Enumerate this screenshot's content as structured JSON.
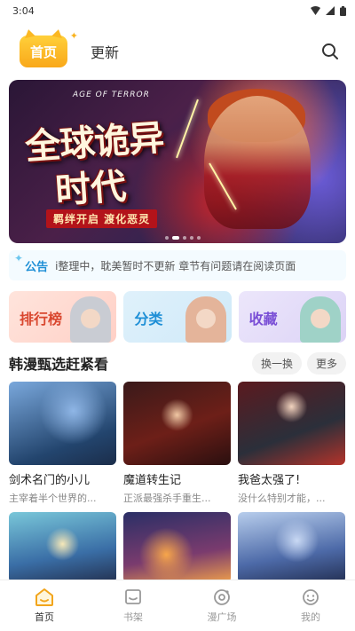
{
  "status_bar": {
    "time": "3:04"
  },
  "header": {
    "tabs": [
      {
        "label": "首页"
      },
      {
        "label": "更新"
      }
    ]
  },
  "banner": {
    "title_en": "AGE OF TERROR",
    "title_line1": "全球诡异",
    "title_line2": "时代",
    "tagline": "羁绊开启 渡化恶灵"
  },
  "notice": {
    "label": "公告",
    "text": "i整理中，耽美暂时不更新 章节有问题请在阅读页面"
  },
  "categories": [
    {
      "label": "排行榜"
    },
    {
      "label": "分类"
    },
    {
      "label": "收藏"
    }
  ],
  "section": {
    "title": "韩漫甄选赶紧看",
    "refresh_label": "换一换",
    "more_label": "更多"
  },
  "books": [
    {
      "title": "剑术名门的小儿",
      "desc": "主宰着半个世界的..."
    },
    {
      "title": "魔道转生记",
      "desc": "正派最强杀手重生..."
    },
    {
      "title": "我爸太强了!",
      "desc": "没什么特别才能，..."
    }
  ],
  "bottom_nav": [
    {
      "label": "首页",
      "icon": "home-icon"
    },
    {
      "label": "书架",
      "icon": "bookshelf-icon"
    },
    {
      "label": "漫广场",
      "icon": "plaza-icon"
    },
    {
      "label": "我的",
      "icon": "profile-icon"
    }
  ],
  "colors": {
    "accent": "#f9a81a",
    "notice": "#1e8fd6",
    "text": "#222222",
    "muted": "#888888"
  }
}
